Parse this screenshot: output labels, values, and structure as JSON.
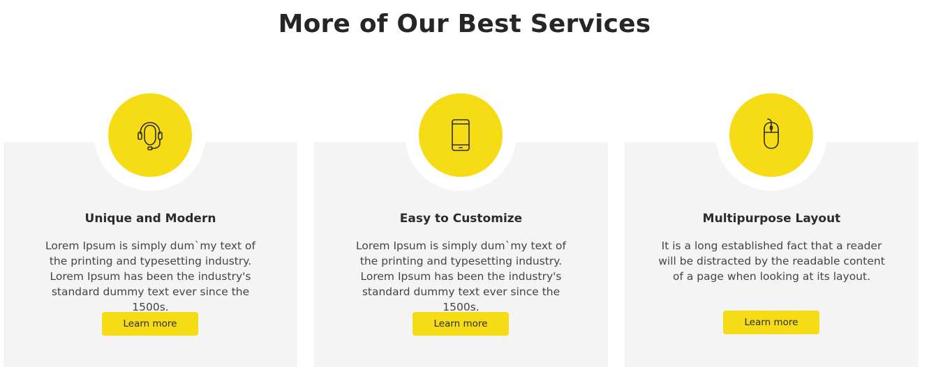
{
  "section": {
    "title": "More of Our Best Services"
  },
  "cards": [
    {
      "icon": "headset-icon",
      "title": "Unique and Modern",
      "text": "Lorem Ipsum is simply dum`my text of the printing and typesetting industry. Lorem Ipsum has been the industry's standard dummy text ever since the 1500s.",
      "button_label": "Learn more"
    },
    {
      "icon": "smartphone-icon",
      "title": "Easy to Customize",
      "text": "Lorem Ipsum is simply dum`my text of the printing and typesetting industry. Lorem Ipsum has been the industry's standard dummy text ever since the 1500s.",
      "button_label": "Learn more"
    },
    {
      "icon": "mouse-icon",
      "title": "Multipurpose Layout",
      "text": "It is a long established fact that a reader will be distracted by the readable content of a page when looking at its layout.",
      "button_label": "Learn more"
    }
  ],
  "colors": {
    "accent": "#f5dc14",
    "card_background": "#f4f4f4",
    "heading": "#262626"
  }
}
